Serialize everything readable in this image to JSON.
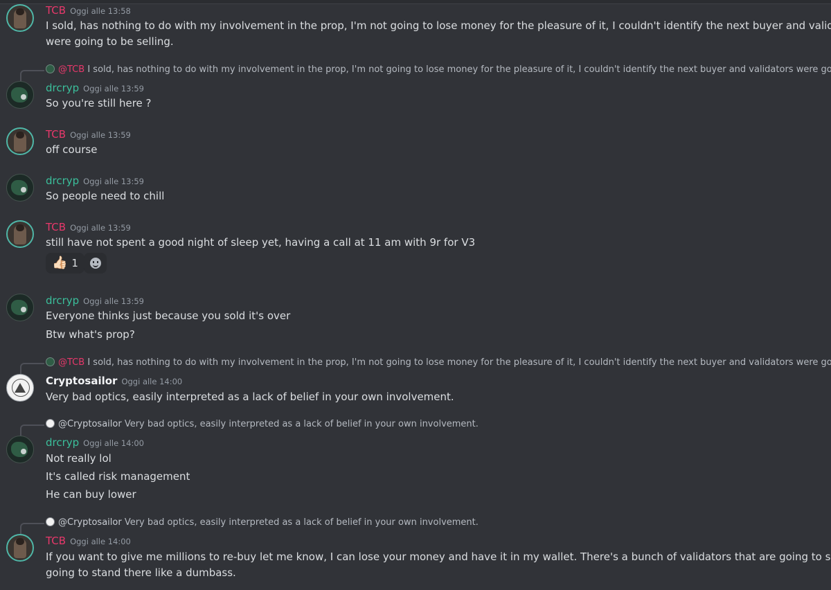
{
  "messages": [
    {
      "author": "TCB",
      "timestamp": "Oggi alle 13:58",
      "lines": [
        "I sold, has nothing to do with my involvement in the prop, I'm not going to lose money for the pleasure of it, I couldn't identify the next buyer and validators",
        "were going to be selling."
      ]
    },
    {
      "reply": {
        "mention": "@TCB",
        "text": "I sold, has nothing to do with my involvement in the prop, I'm not going to lose money for the pleasure of it, I couldn't identify the next buyer and validators were going to ..."
      },
      "author": "drcryp",
      "timestamp": "Oggi alle 13:59",
      "lines": [
        "So you're still here ?"
      ]
    },
    {
      "author": "TCB",
      "timestamp": "Oggi alle 13:59",
      "lines": [
        "off course"
      ]
    },
    {
      "author": "drcryp",
      "timestamp": "Oggi alle 13:59",
      "lines": [
        "So people need to chill"
      ]
    },
    {
      "author": "TCB",
      "timestamp": "Oggi alle 13:59",
      "lines": [
        "still have not spent a good night of sleep yet, having a call at 11 am with 9r for V3"
      ],
      "reaction": {
        "emoji": "👍🏻",
        "count": "1"
      }
    },
    {
      "author": "drcryp",
      "timestamp": "Oggi alle 13:59",
      "lines": [
        "Everyone thinks just because you sold it's over",
        "Btw what's prop?"
      ]
    },
    {
      "reply": {
        "mention": "@TCB",
        "text": "I sold, has nothing to do with my involvement in the prop, I'm not going to lose money for the pleasure of it, I couldn't identify the next buyer and validators were going to ..."
      },
      "author": "Cryptosailor",
      "timestamp": "Oggi alle 14:00",
      "lines": [
        "Very bad optics, easily interpreted as a lack of belief in your own involvement."
      ]
    },
    {
      "reply": {
        "mention": "@Cryptosailor",
        "text": "Very bad optics, easily interpreted as a lack of belief in your own involvement."
      },
      "author": "drcryp",
      "timestamp": "Oggi alle 14:00",
      "lines": [
        "Not really lol",
        "It's called risk management",
        "He can buy lower"
      ]
    },
    {
      "reply": {
        "mention": "@Cryptosailor",
        "text": "Very bad optics, easily interpreted as a lack of belief in your own involvement."
      },
      "author": "TCB",
      "timestamp": "Oggi alle 14:00",
      "lines": [
        "If you want to give me millions to re-buy let me know, I can lose your money and have it in my wallet. There's a bunch of validators that are going to sell I'm not",
        "going to stand there like a dumbass."
      ]
    }
  ]
}
